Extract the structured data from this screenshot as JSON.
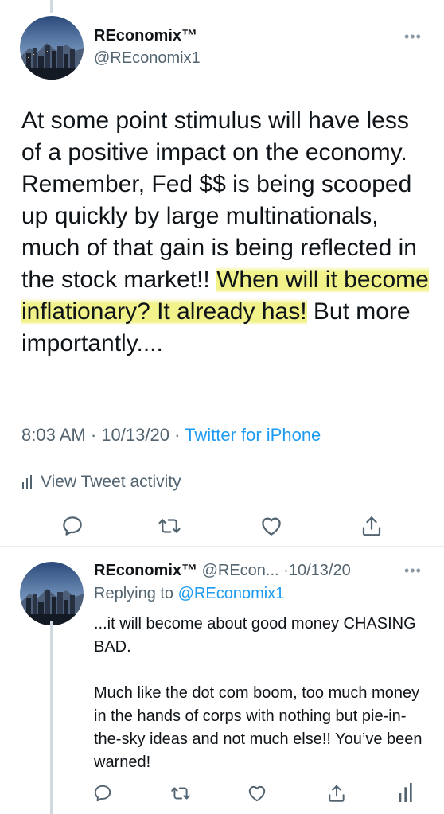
{
  "main_tweet": {
    "display_name": "REconomix™",
    "handle": "@REconomix1",
    "text_plain_1": "At some point stimulus will have less of a positive impact on the economy. Remember, Fed $$ is being scooped up quickly by large multinationals, much of that gain is being reflected in the stock market!! ",
    "text_highlight": "When will it become inflationary? It already has!",
    "text_plain_2": " But more importantly....",
    "time": "8:03 AM",
    "date": "10/13/20",
    "source": "Twitter for iPhone",
    "activity_label": "View Tweet activity"
  },
  "reply_tweet": {
    "display_name": "REconomix™",
    "handle": "@REcon...",
    "date": "10/13/20",
    "replying_prefix": "Replying to ",
    "replying_to": "@REconomix1",
    "text": "...it will become about good money CHASING BAD.\n\nMuch like the dot com boom, too much money in the hands of corps with nothing but pie-in-the-sky ideas and not much else!! You’ve been warned!"
  },
  "icons": {
    "more": "more-icon",
    "reply": "reply-icon",
    "retweet": "retweet-icon",
    "like": "heart-icon",
    "share": "share-icon",
    "activity": "analytics-icon"
  },
  "colors": {
    "link": "#1d9bf0",
    "secondary_text": "#536471",
    "highlight": "#f1f28a"
  }
}
